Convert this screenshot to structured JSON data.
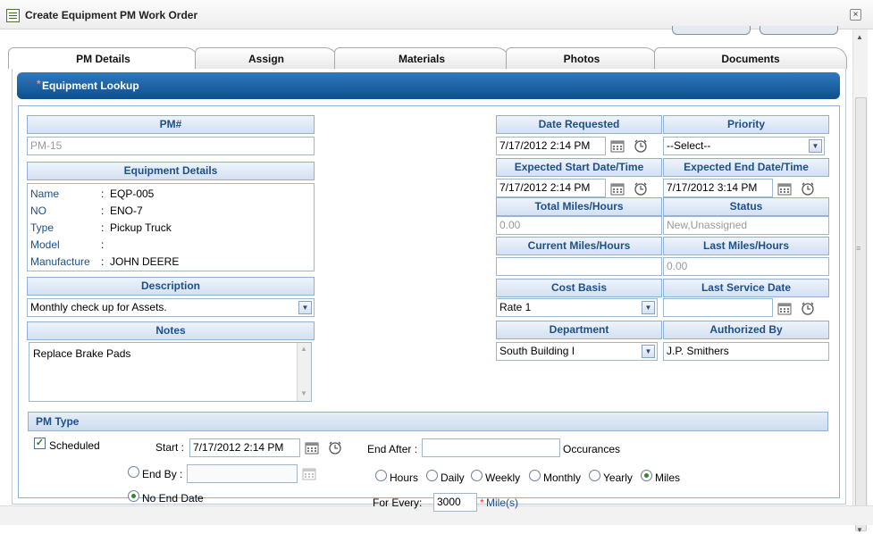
{
  "window": {
    "title": "Create Equipment PM Work Order",
    "close_label": "×"
  },
  "tabs": [
    {
      "label": "PM Details"
    },
    {
      "label": "Assign"
    },
    {
      "label": "Materials"
    },
    {
      "label": "Photos"
    },
    {
      "label": "Documents"
    }
  ],
  "lookup": {
    "required_mark": "*",
    "label": "Equipment Lookup"
  },
  "pm": {
    "label": "PM#",
    "value": "PM-15"
  },
  "equipment": {
    "label": "Equipment Details",
    "rows": [
      {
        "key": "Name",
        "sep": ":",
        "value": "EQP-005"
      },
      {
        "key": "NO",
        "sep": ":",
        "value": "ENO-7"
      },
      {
        "key": "Type",
        "sep": ":",
        "value": "Pickup Truck"
      },
      {
        "key": "Model",
        "sep": ":",
        "value": ""
      },
      {
        "key": "Manufacture",
        "sep": ":",
        "value": "JOHN DEERE"
      }
    ]
  },
  "description": {
    "label": "Description",
    "value": "Monthly check up for Assets."
  },
  "notes": {
    "label": "Notes",
    "value": "Replace Brake Pads"
  },
  "date_requested": {
    "label": "Date Requested",
    "value": "7/17/2012 2:14 PM"
  },
  "priority": {
    "label": "Priority",
    "value": "--Select--"
  },
  "expected_start": {
    "label": "Expected Start Date/Time",
    "value": "7/17/2012 2:14 PM"
  },
  "expected_end": {
    "label": "Expected End Date/Time",
    "value": "7/17/2012 3:14 PM"
  },
  "total_miles": {
    "label": "Total Miles/Hours",
    "value": "0.00"
  },
  "status": {
    "label": "Status",
    "value": "New,Unassigned"
  },
  "current_miles": {
    "label": "Current Miles/Hours",
    "value": ""
  },
  "last_miles": {
    "label": "Last Miles/Hours",
    "value": "0.00"
  },
  "cost_basis": {
    "label": "Cost Basis",
    "value": "Rate 1"
  },
  "last_service": {
    "label": "Last Service Date",
    "value": ""
  },
  "department": {
    "label": "Department",
    "value": "South Building I"
  },
  "authorized_by": {
    "label": "Authorized By",
    "value": "J.P. Smithers"
  },
  "pm_type": {
    "label": "PM Type",
    "scheduled_label": "Scheduled",
    "start_label": "Start :",
    "start_value": "7/17/2012 2:14 PM",
    "end_by_label": "End By :",
    "end_by_value": "",
    "no_end_label": "No End Date",
    "end_after_label": "End After :",
    "end_after_value": "",
    "occurances_label": "Occurances",
    "freq": [
      "Hours",
      "Daily",
      "Weekly",
      "Monthly",
      "Yearly",
      "Miles"
    ],
    "for_every_label": "For Every:",
    "for_every_value": "3000",
    "unit_required_mark": "*",
    "unit_label": "Mile(s)"
  },
  "colors": {
    "accent": "#1d4f8c",
    "header_blue": "#0d4f8f",
    "radio_on": "#2d8a2d"
  }
}
